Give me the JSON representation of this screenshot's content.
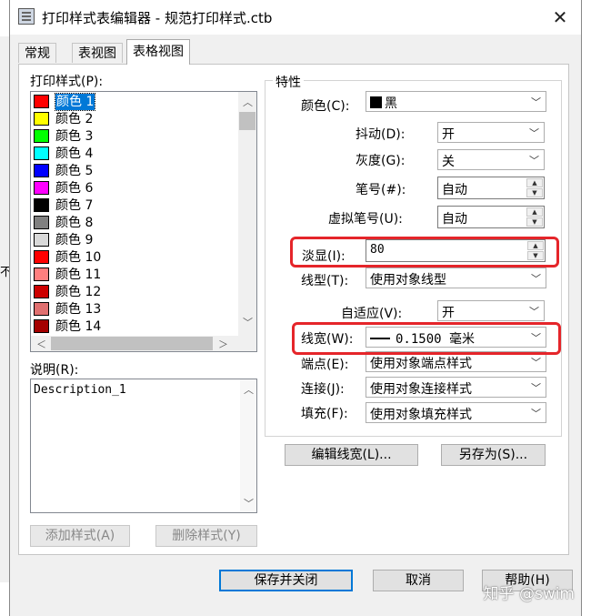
{
  "window": {
    "title": "打印样式表编辑器 - 规范打印样式.ctb",
    "close": "✕"
  },
  "tabs": [
    {
      "label": "常规"
    },
    {
      "label": "表视图"
    },
    {
      "label": "表格视图"
    }
  ],
  "left": {
    "styles_label": "打印样式(P):",
    "styles": [
      {
        "label": "颜色 1",
        "color": "#ff0000",
        "selected": true
      },
      {
        "label": "颜色 2",
        "color": "#ffff00"
      },
      {
        "label": "颜色 3",
        "color": "#00ff00"
      },
      {
        "label": "颜色 4",
        "color": "#00ffff"
      },
      {
        "label": "颜色 5",
        "color": "#0000ff"
      },
      {
        "label": "颜色 6",
        "color": "#ff00ff"
      },
      {
        "label": "颜色 7",
        "color": "#000000"
      },
      {
        "label": "颜色 8",
        "color": "#808080"
      },
      {
        "label": "颜色 9",
        "color": "#d9d9d9"
      },
      {
        "label": "颜色 10",
        "color": "#ff0000"
      },
      {
        "label": "颜色 11",
        "color": "#ff7f7f"
      },
      {
        "label": "颜色 12",
        "color": "#cc0000"
      },
      {
        "label": "颜色 13",
        "color": "#e07070"
      },
      {
        "label": "颜色 14",
        "color": "#a50000"
      }
    ],
    "description_label": "说明(R):",
    "description_value": "Description_1",
    "add_style": "添加样式(A)",
    "delete_style": "删除样式(Y)"
  },
  "props": {
    "group_title": "特性",
    "color_label": "颜色(C):",
    "color_value": "黑",
    "dither_label": "抖动(D):",
    "dither_value": "开",
    "grayscale_label": "灰度(G):",
    "grayscale_value": "关",
    "pen_label": "笔号(#):",
    "pen_value": "自动",
    "vpen_label": "虚拟笔号(U):",
    "vpen_value": "自动",
    "screening_label": "淡显(I):",
    "screening_value": "80",
    "linetype_label": "线型(T):",
    "linetype_value": "使用对象线型",
    "adaptive_label": "自适应(V):",
    "adaptive_value": "开",
    "lineweight_label": "线宽(W):",
    "lineweight_value": "0.1500 毫米",
    "endstyle_label": "端点(E):",
    "endstyle_value": "使用对象端点样式",
    "joinstyle_label": "连接(J):",
    "joinstyle_value": "使用对象连接样式",
    "fillstyle_label": "填充(F):",
    "fillstyle_value": "使用对象填充样式",
    "edit_lineweights": "编辑线宽(L)...",
    "save_as": "另存为(S)..."
  },
  "footer": {
    "save_close": "保存并关闭",
    "cancel": "取消",
    "help": "帮助(H)"
  },
  "watermark": "知乎 @swim",
  "colors": {
    "accent": "#0078d7",
    "highlight": "#e5252a"
  }
}
